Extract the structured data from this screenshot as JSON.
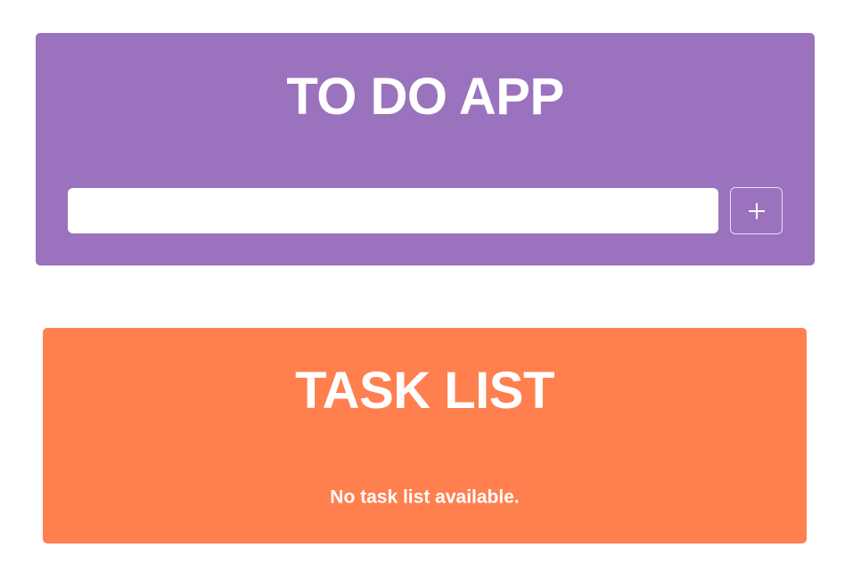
{
  "app": {
    "title": "TO DO APP",
    "input_value": "",
    "input_placeholder": "",
    "add_button_icon": "plus-icon"
  },
  "task_list": {
    "title": "TASK LIST",
    "empty_message": "No task list available.",
    "tasks": []
  },
  "colors": {
    "todo_card": "#9b72bd",
    "task_list_card": "#ff7f4f",
    "text": "#ffffff",
    "input_background": "#ffffff"
  }
}
